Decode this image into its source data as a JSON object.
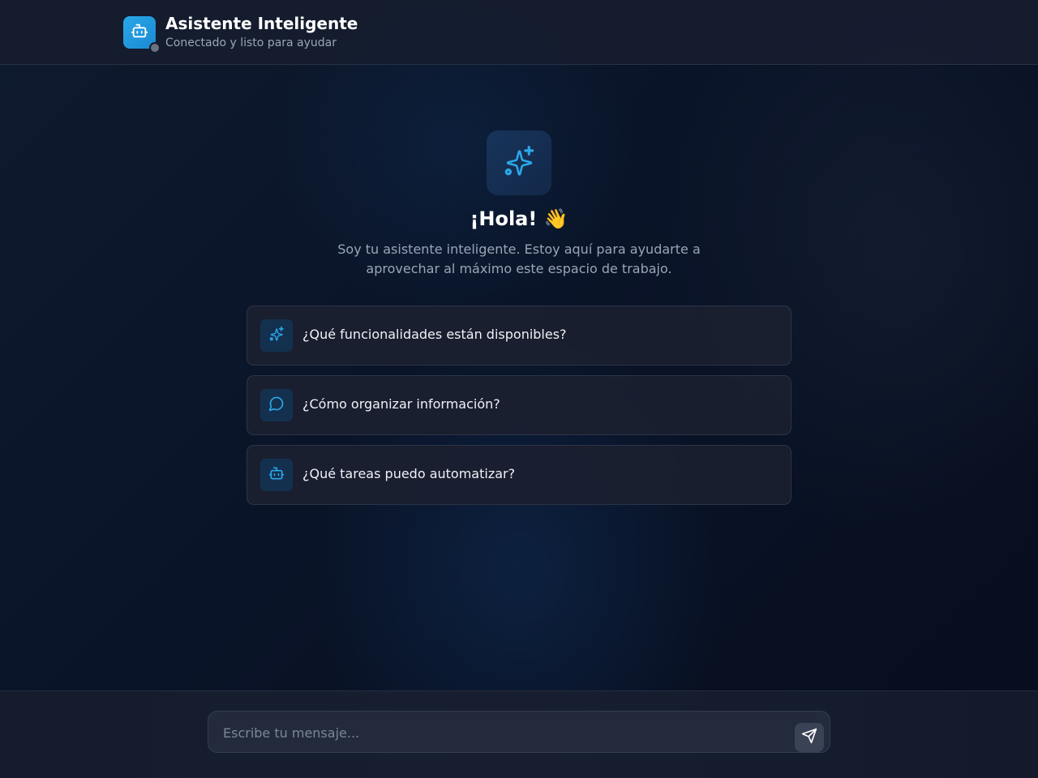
{
  "header": {
    "title": "Asistente Inteligente",
    "subtitle": "Conectado y listo para ayudar",
    "avatar_icon": "robot-icon",
    "status": "offline"
  },
  "welcome": {
    "icon": "sparkles-icon",
    "greeting": "¡Hola! 👋",
    "intro": "Soy tu asistente inteligente. Estoy aquí para ayudarte a aprovechar al máximo este espacio de trabajo."
  },
  "suggestions": [
    {
      "icon": "sparkles-icon",
      "label": "¿Qué funcionalidades están disponibles?"
    },
    {
      "icon": "chat-bubble-icon",
      "label": "¿Cómo organizar información?"
    },
    {
      "icon": "robot-icon",
      "label": "¿Qué tareas puedo automatizar?"
    }
  ],
  "composer": {
    "placeholder": "Escribe tu mensaje...",
    "value": "",
    "send_icon": "send-icon"
  },
  "colors": {
    "accent": "#2aa8e8",
    "background": "#0a1428"
  }
}
